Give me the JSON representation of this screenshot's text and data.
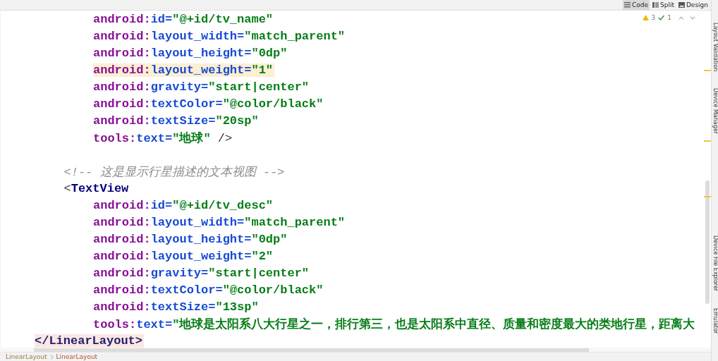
{
  "view_tabs": [
    {
      "label": "Code",
      "selected": true
    },
    {
      "label": "Split",
      "selected": false
    },
    {
      "label": "Design",
      "selected": false
    }
  ],
  "inspections": {
    "warnings": "3",
    "checks": "1"
  },
  "code_lines": [
    {
      "kind": "attribute",
      "prefix": "android:",
      "name": "id=",
      "value": "\"@+id/tv_name\"",
      "highlighted": false
    },
    {
      "kind": "attribute",
      "prefix": "android:",
      "name": "layout_width=",
      "value": "\"match_parent\"",
      "highlighted": false
    },
    {
      "kind": "attribute",
      "prefix": "android:",
      "name": "layout_height=",
      "value": "\"0dp\"",
      "highlighted": false
    },
    {
      "kind": "attribute",
      "prefix": "android:",
      "name": "layout_weight=",
      "value": "\"1\"",
      "highlighted": true
    },
    {
      "kind": "attribute",
      "prefix": "android:",
      "name": "gravity=",
      "value": "\"start|center\"",
      "highlighted": false
    },
    {
      "kind": "attribute",
      "prefix": "android:",
      "name": "textColor=",
      "value": "\"@color/black\"",
      "highlighted": false
    },
    {
      "kind": "attribute",
      "prefix": "android:",
      "name": "textSize=",
      "value": "\"20sp\"",
      "highlighted": false
    },
    {
      "kind": "attribute",
      "prefix": "tools:",
      "name": "text=",
      "value": "\"地球\"",
      "tail": " />",
      "highlighted": false
    },
    {
      "kind": "blank"
    },
    {
      "kind": "comment",
      "text": "<!-- 这是显示行星描述的文本视图 -->"
    },
    {
      "kind": "open_tag",
      "bracket": "<",
      "tag": "TextView"
    },
    {
      "kind": "attribute",
      "prefix": "android:",
      "name": "id=",
      "value": "\"@+id/tv_desc\"",
      "highlighted": false
    },
    {
      "kind": "attribute",
      "prefix": "android:",
      "name": "layout_width=",
      "value": "\"match_parent\"",
      "highlighted": false
    },
    {
      "kind": "attribute",
      "prefix": "android:",
      "name": "layout_height=",
      "value": "\"0dp\"",
      "highlighted": false
    },
    {
      "kind": "attribute",
      "prefix": "android:",
      "name": "layout_weight=",
      "value": "\"2\"",
      "highlighted": false
    },
    {
      "kind": "attribute",
      "prefix": "android:",
      "name": "gravity=",
      "value": "\"start|center\"",
      "highlighted": false
    },
    {
      "kind": "attribute",
      "prefix": "android:",
      "name": "textColor=",
      "value": "\"@color/black\"",
      "highlighted": false
    },
    {
      "kind": "attribute",
      "prefix": "android:",
      "name": "textSize=",
      "value": "\"13sp\"",
      "highlighted": false
    },
    {
      "kind": "attribute",
      "prefix": "tools:",
      "name": "text=",
      "value": "\"地球是太阳系八大行星之一，排行第三，也是太阳系中直径、质量和密度最大的类地行星，距离大",
      "highlighted": false
    },
    {
      "kind": "close_tag",
      "text": "</LinearLayout>",
      "highlighted": true
    }
  ],
  "breadcrumb": [
    "LinearLayout",
    "LinearLayout"
  ],
  "tool_strip": [
    "Layout Validation",
    "Device Manager",
    "Device File Explorer",
    "Emulator"
  ]
}
